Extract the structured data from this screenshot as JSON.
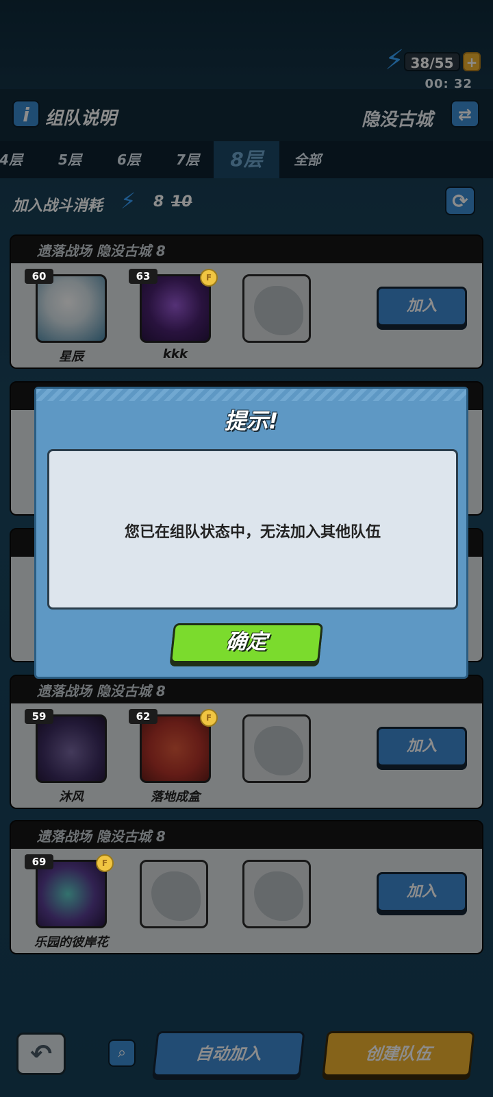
{
  "status": {
    "energy": "38/55",
    "energy_plus": "+",
    "timer": "00: 32"
  },
  "header": {
    "info_icon": "i",
    "title": "组队说明",
    "zone": "隐没古城",
    "swap_icon": "⇄"
  },
  "tabs": [
    {
      "label": "4层"
    },
    {
      "label": "5层"
    },
    {
      "label": "6层"
    },
    {
      "label": "7层"
    },
    {
      "label": "8层",
      "active": true
    },
    {
      "label": "全部"
    }
  ],
  "cost": {
    "label": "加入战斗消耗",
    "value": "8",
    "old_value": "10"
  },
  "teams": [
    {
      "title": "遗落战场 隐没古城 8",
      "members": [
        {
          "level": "60",
          "name": "星辰"
        },
        {
          "level": "63",
          "name": "kkk",
          "badge": "F"
        }
      ],
      "join_label": "加入"
    },
    {
      "title": "遗落战场 隐没古城 8",
      "members": [
        {
          "level": "59",
          "name": "沐风"
        },
        {
          "level": "62",
          "name": "落地成盒",
          "badge": "F"
        }
      ],
      "join_label": "加入"
    },
    {
      "title": "遗落战场 隐没古城 8",
      "members": [
        {
          "level": "69",
          "name": "乐园的彼岸花",
          "badge": "F"
        }
      ],
      "join_label": "加入"
    }
  ],
  "dialog": {
    "title": "提示!",
    "message": "您已在组队状态中，无法加入其他队伍",
    "confirm_label": "确定"
  },
  "bottom": {
    "back_icon": "↶",
    "search_icon": "⌕",
    "auto_join_label": "自动加入",
    "create_team_label": "创建队伍"
  },
  "colors": {
    "accent_blue": "#3f8bd3",
    "confirm_green": "#7bdb2d",
    "create_yellow": "#f2b531"
  }
}
